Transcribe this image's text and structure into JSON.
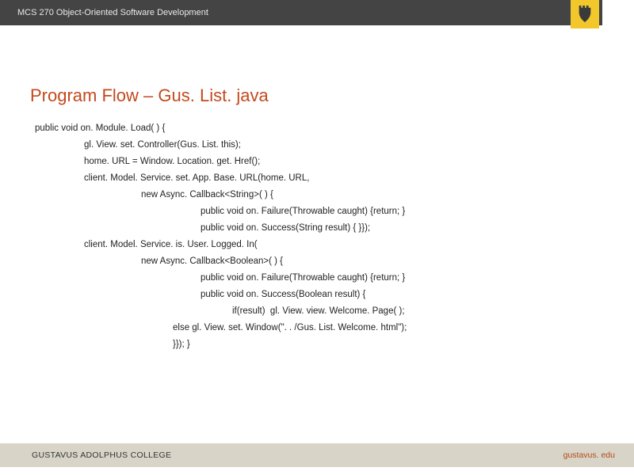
{
  "header": {
    "course": "MCS 270 Object-Oriented Software Development"
  },
  "title": "Program Flow – Gus. List. java",
  "code": {
    "l1": "public void on. Module. Load( ) {",
    "l2": "gl. View. set. Controller(Gus. List. this);",
    "l3": "home. URL = Window. Location. get. Href();",
    "l4": "client. Model. Service. set. App. Base. URL(home. URL,",
    "l5": "new Async. Callback<String>( ) {",
    "l6": "public void on. Failure(Throwable caught) {return; }",
    "l7": "public void on. Success(String result) { }});",
    "l8": "client. Model. Service. is. User. Logged. In(",
    "l9": "new Async. Callback<Boolean>( ) {",
    "l10": "public void on. Failure(Throwable caught) {return; }",
    "l11": "public void on. Success(Boolean result) {",
    "l12": "if(result)  gl. View. view. Welcome. Page( );",
    "l13": "else gl. View. set. Window(\". . /Gus. List. Welcome. html\");",
    "l14": "}}); }"
  },
  "footer": {
    "left": "GUSTAVUS ADOLPHUS COLLEGE",
    "right": "gustavus. edu"
  }
}
